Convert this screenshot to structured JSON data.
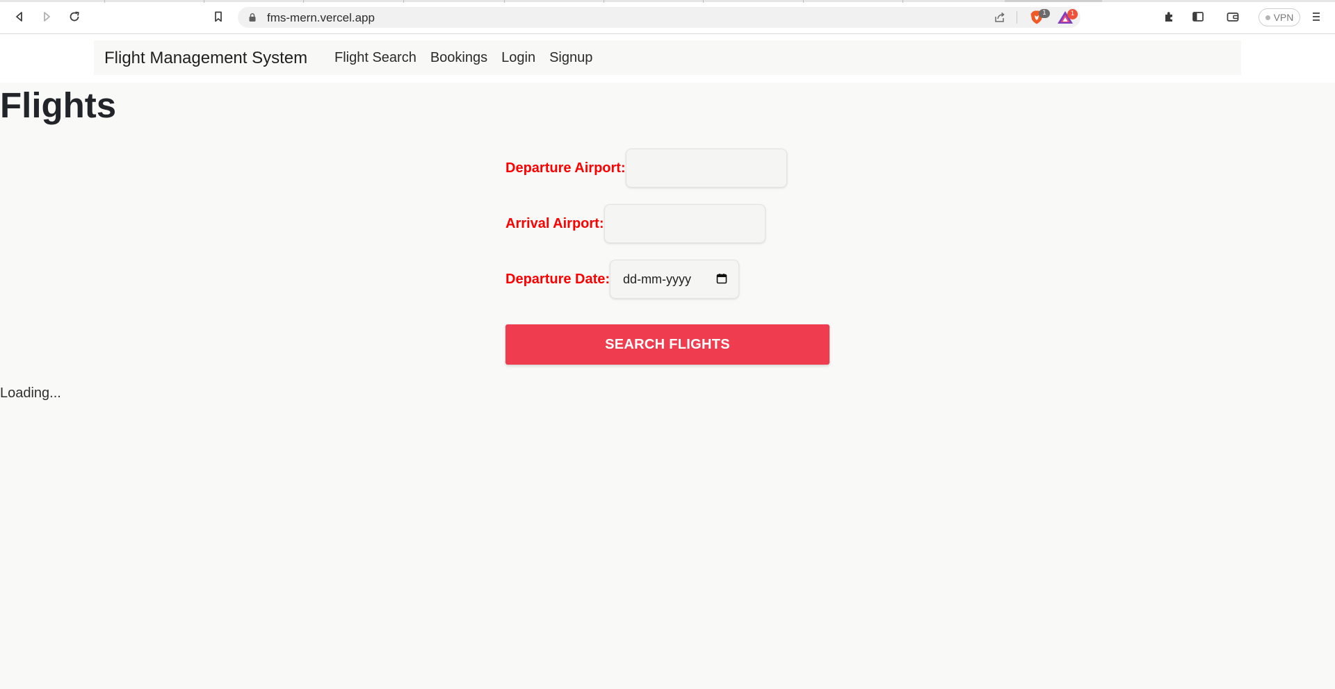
{
  "browser": {
    "url": "fms-mern.vercel.app",
    "brave_shield_count": "1",
    "rewards_count": "1",
    "vpn_label": "VPN"
  },
  "navbar": {
    "brand": "Flight Management System",
    "links": [
      "Flight Search",
      "Bookings",
      "Login",
      "Signup"
    ]
  },
  "page": {
    "title": "Flights",
    "status": "Loading..."
  },
  "form": {
    "departure_airport_label": "Departure Airport:",
    "departure_airport_value": "",
    "arrival_airport_label": "Arrival Airport:",
    "arrival_airport_value": "",
    "departure_date_label": "Departure Date:",
    "departure_date_placeholder": "dd-mm-yyyy",
    "search_button": "SEARCH FLIGHTS"
  },
  "colors": {
    "label": "#ff0000",
    "button": "#ef3d4f",
    "background": "#f9f9f8"
  },
  "icons": [
    "back-icon",
    "forward-icon",
    "reload-icon",
    "bookmark-icon",
    "lock-icon",
    "share-icon",
    "brave-shield-icon",
    "brave-rewards-icon",
    "extensions-icon",
    "sidebar-icon",
    "wallet-icon",
    "menu-icon",
    "calendar-icon"
  ]
}
